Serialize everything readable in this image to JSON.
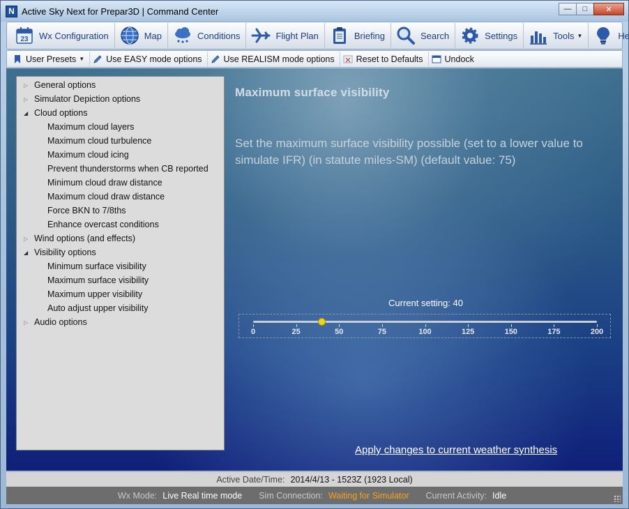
{
  "window": {
    "title": "Active Sky Next for Prepar3D | Command Center",
    "app_icon_letter": "N",
    "minimize": "—",
    "maximize": "□",
    "close": "✕"
  },
  "nav": {
    "items": [
      {
        "label": "Wx Configuration",
        "icon": "calendar-icon",
        "badge": "23"
      },
      {
        "label": "Map",
        "icon": "globe-icon"
      },
      {
        "label": "Conditions",
        "icon": "cloud-rain-icon"
      },
      {
        "label": "Flight Plan",
        "icon": "airplane-icon"
      },
      {
        "label": "Briefing",
        "icon": "clipboard-icon"
      },
      {
        "label": "Search",
        "icon": "magnifier-icon"
      },
      {
        "label": "Settings",
        "icon": "gear-icon"
      },
      {
        "label": "Tools",
        "icon": "bar-chart-icon"
      },
      {
        "label": "Help",
        "icon": "lightbulb-icon"
      }
    ]
  },
  "subbar": {
    "items": [
      {
        "label": "User Presets",
        "icon": "bookmark-icon"
      },
      {
        "label": "Use EASY mode options",
        "icon": "pencil-icon"
      },
      {
        "label": "Use REALISM mode options",
        "icon": "pencil-icon"
      },
      {
        "label": "Reset to Defaults",
        "icon": "reset-icon"
      },
      {
        "label": "Undock",
        "icon": "window-icon"
      }
    ]
  },
  "tree": {
    "items": [
      {
        "label": "General options",
        "level": 0,
        "expander": "closed"
      },
      {
        "label": "Simulator Depiction options",
        "level": 0,
        "expander": "closed"
      },
      {
        "label": "Cloud options",
        "level": 0,
        "expander": "open"
      },
      {
        "label": "Maximum cloud layers",
        "level": 1
      },
      {
        "label": "Maximum cloud turbulence",
        "level": 1
      },
      {
        "label": "Maximum cloud icing",
        "level": 1
      },
      {
        "label": "Prevent thunderstorms when CB reported",
        "level": 1
      },
      {
        "label": "Minimum cloud draw distance",
        "level": 1
      },
      {
        "label": "Maximum cloud draw distance",
        "level": 1
      },
      {
        "label": "Force BKN to 7/8ths",
        "level": 1
      },
      {
        "label": "Enhance overcast conditions",
        "level": 1
      },
      {
        "label": "Wind options (and effects)",
        "level": 0,
        "expander": "closed"
      },
      {
        "label": "Visibility options",
        "level": 0,
        "expander": "open"
      },
      {
        "label": "Minimum surface visibility",
        "level": 1
      },
      {
        "label": "Maximum surface visibility",
        "level": 1
      },
      {
        "label": "Maximum upper visibility",
        "level": 1
      },
      {
        "label": "Auto adjust upper visibility",
        "level": 1
      },
      {
        "label": "Audio options",
        "level": 0,
        "expander": "closed"
      }
    ]
  },
  "main": {
    "heading": "Maximum surface visibility",
    "description": "Set the maximum surface visibility possible (set to a lower value to simulate IFR) (in statute miles-SM)  (default value: 75)",
    "current_setting_label": "Current setting: 40",
    "slider": {
      "min": 0,
      "max": 200,
      "value": 40,
      "ticks": [
        "0",
        "25",
        "50",
        "75",
        "100",
        "125",
        "150",
        "175",
        "200"
      ]
    },
    "apply_link": "Apply changes to current weather synthesis"
  },
  "status": {
    "date_label": "Active Date/Time:",
    "date_value": "2014/4/13 - 1523Z (1923 Local)",
    "wx_mode_label": "Wx Mode:",
    "wx_mode_value": "Live Real time mode",
    "sim_label": "Sim Connection:",
    "sim_value": "Waiting for Simulator",
    "activity_label": "Current Activity:",
    "activity_value": "Idle"
  },
  "colors": {
    "nav_text": "#1f3f80",
    "slider_thumb": "#f6d21c",
    "status_warning": "#f7a21b"
  }
}
